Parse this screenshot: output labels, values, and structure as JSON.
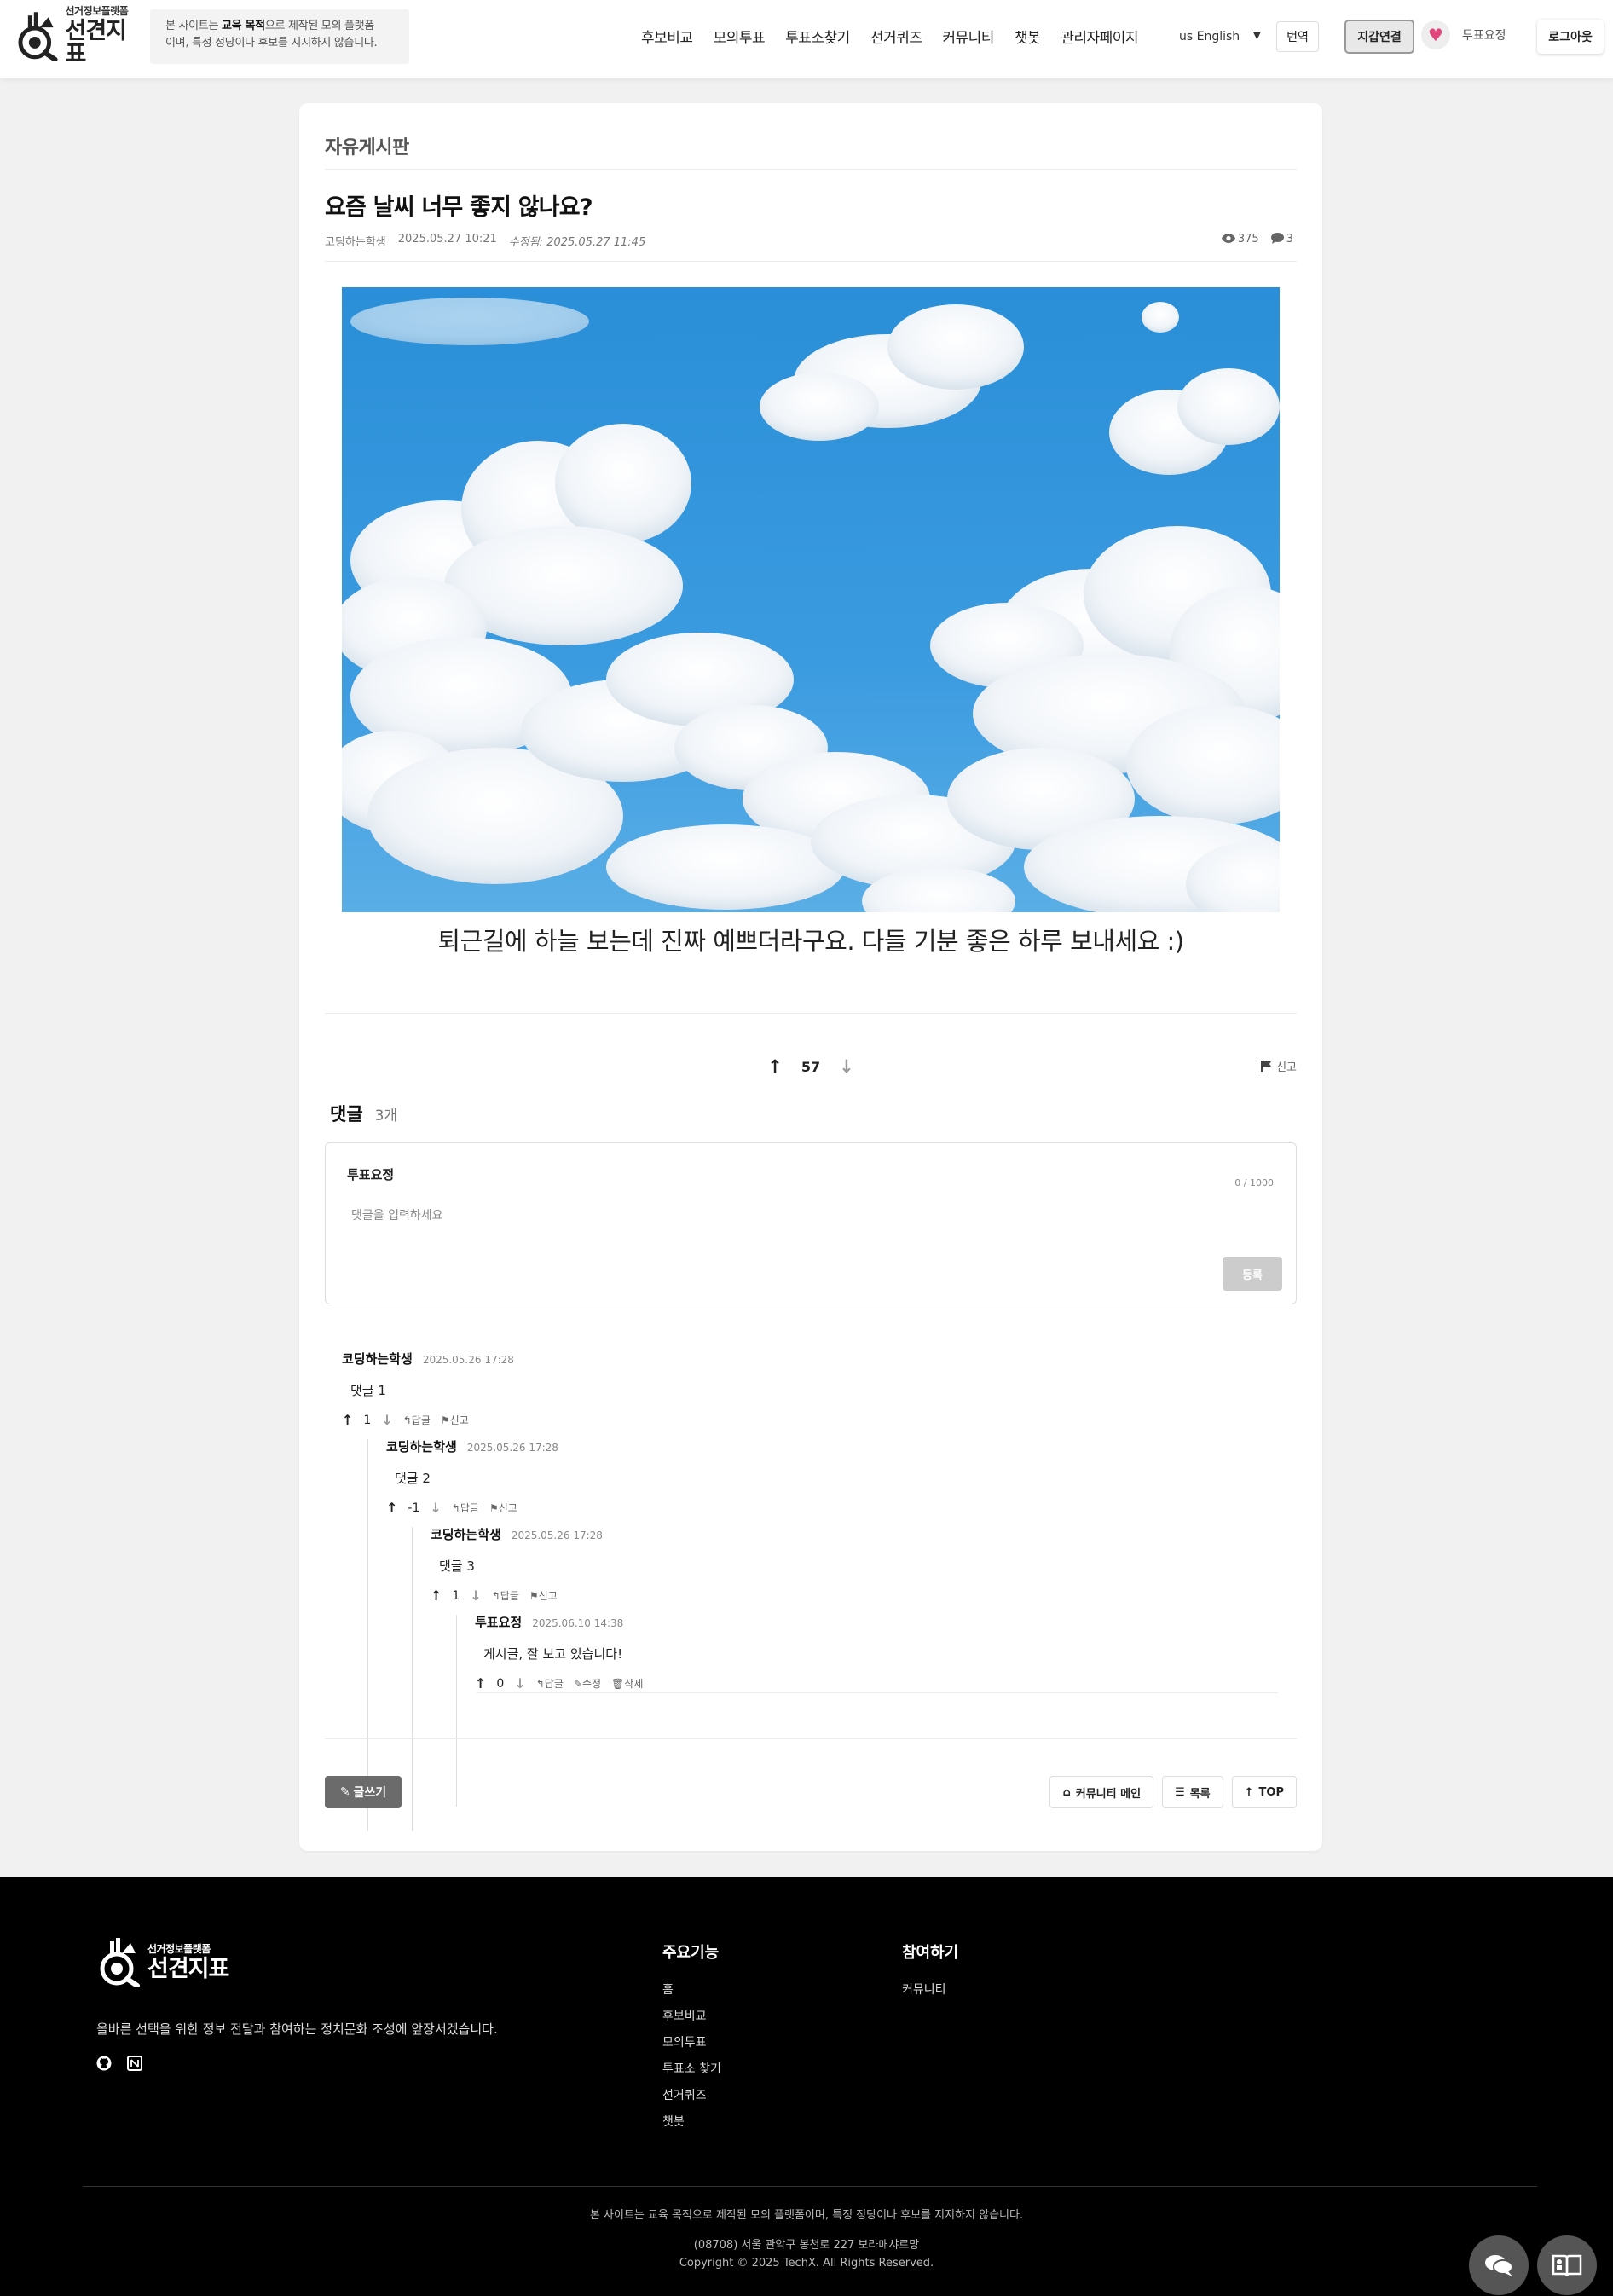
{
  "header": {
    "logo_sub": "선거정보플랫폼",
    "logo_main": "선견지표",
    "notice_pre": "본 사이트는 ",
    "notice_bold": "교육 목적",
    "notice_post": "으로 제작된 모의 플랫폼",
    "notice_line2": "이며, 특정 정당이나 후보를 지지하지 않습니다.",
    "nav": [
      "후보비교",
      "모의투표",
      "투표소찾기",
      "선거퀴즈",
      "커뮤니티",
      "챗봇",
      "관리자페이지"
    ],
    "language": "us English",
    "translate_label": "번역",
    "wallet_label": "지갑연결",
    "user_name": "투표요정",
    "logout_label": "로그아웃"
  },
  "post": {
    "board": "자유게시판",
    "title": "요즘 날씨 너무 좋지 않나요?",
    "author": "코딩하는학생",
    "created": "2025.05.27 10:21",
    "edited": "수정됨: 2025.05.27 11:45",
    "views": "375",
    "comments": "3",
    "body": "퇴근길에 하늘 보는데 진짜 예쁘더라구요. 다들 기분 좋은 하루 보내세요 :)",
    "votes": "57",
    "report_label": "신고"
  },
  "comments_section": {
    "title": "댓글",
    "count": "3개",
    "form_user": "투표요정",
    "form_counter": "0 / 1000",
    "form_placeholder": "댓글을 입력하세요",
    "submit_label": "등록"
  },
  "comments": [
    {
      "author": "코딩하는학생",
      "time": "2025.05.26 17:28",
      "text": "댓글 1",
      "votes": "1",
      "reply": "답글",
      "report": "신고"
    },
    {
      "author": "코딩하는학생",
      "time": "2025.05.26 17:28",
      "text": "댓글 2",
      "votes": "-1",
      "reply": "답글",
      "report": "신고"
    },
    {
      "author": "코딩하는학생",
      "time": "2025.05.26 17:28",
      "text": "댓글 3",
      "votes": "1",
      "reply": "답글",
      "report": "신고"
    },
    {
      "author": "투표요정",
      "time": "2025.06.10 14:38",
      "text": "게시글, 잘 보고 있습니다!",
      "votes": "0",
      "reply": "답글",
      "edit": "수정",
      "delete": "삭제"
    }
  ],
  "actions": {
    "write": "글쓰기",
    "community_main": "커뮤니티 메인",
    "list": "목록",
    "top": "TOP"
  },
  "footer": {
    "logo_sub": "선거정보플랫폼",
    "logo_main": "선견지표",
    "description": "올바른 선택을 위한 정보 전달과 참여하는 정치문화 조성에 앞장서겠습니다.",
    "main_features_title": "주요기능",
    "main_features": [
      "홈",
      "후보비교",
      "모의투표",
      "투표소 찾기",
      "선거퀴즈",
      "챗봇"
    ],
    "participate_title": "참여하기",
    "participate": [
      "커뮤니티"
    ],
    "disclaimer": "본 사이트는 교육 목적으로 제작된 모의 플랫폼이며, 특정 정당이나 후보를 지지하지 않습니다.",
    "address": "(08708) 서울 관악구 봉천로 227 보라매샤르망",
    "copyright": "Copyright © 2025 TechX. All Rights Reserved."
  },
  "icons": {
    "views": "eye-icon",
    "comments": "comment-icon",
    "report": "flag-icon",
    "reply": "reply-icon",
    "edit": "pencil-icon",
    "delete": "trash-icon",
    "chat_fab": "chat-icon",
    "guide_fab": "book-icon",
    "github": "github-icon",
    "notion": "notion-icon"
  },
  "colors": {
    "accent_dark": "#6b6b6b",
    "footer_bg": "#000000",
    "page_bg": "#f1f1f2"
  }
}
